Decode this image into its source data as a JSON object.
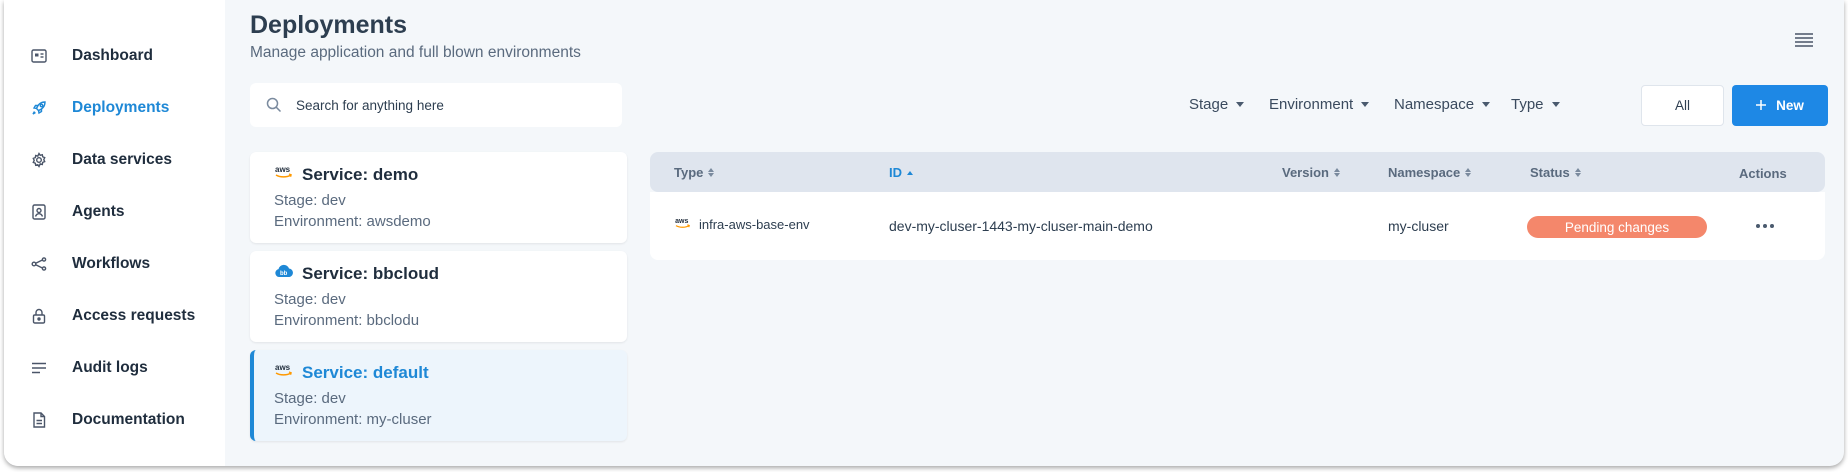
{
  "sidebar": {
    "items": [
      {
        "label": "Dashboard",
        "icon": "dashboard-icon"
      },
      {
        "label": "Deployments",
        "icon": "rocket-icon",
        "active": true
      },
      {
        "label": "Data services",
        "icon": "gear-icon"
      },
      {
        "label": "Agents",
        "icon": "agent-icon"
      },
      {
        "label": "Workflows",
        "icon": "workflow-icon"
      },
      {
        "label": "Access requests",
        "icon": "lock-icon"
      },
      {
        "label": "Audit logs",
        "icon": "list-icon"
      },
      {
        "label": "Documentation",
        "icon": "document-icon"
      }
    ]
  },
  "header": {
    "title": "Deployments",
    "subtitle": "Manage application and full blown environments"
  },
  "search": {
    "placeholder": "Search for anything here",
    "value": ""
  },
  "filters": [
    "Stage",
    "Environment",
    "Namespace",
    "Type"
  ],
  "buttons": {
    "all_label": "All",
    "new_label": "New"
  },
  "services": [
    {
      "name": "Service: demo",
      "stage": "Stage: dev",
      "environment": "Environment: awsdemo",
      "icon": "aws-icon"
    },
    {
      "name": "Service: bbcloud",
      "stage": "Stage: dev",
      "environment": "Environment: bbclodu",
      "icon": "cloud-icon"
    },
    {
      "name": "Service: default",
      "stage": "Stage: dev",
      "environment": "Environment: my-cluser",
      "icon": "aws-icon",
      "selected": true
    }
  ],
  "table": {
    "columns": {
      "type": "Type",
      "id": "ID",
      "version": "Version",
      "namespace": "Namespace",
      "status": "Status",
      "actions": "Actions"
    },
    "rows": [
      {
        "type": "infra-aws-base-env",
        "id": "dev-my-cluser-1443-my-cluser-main-demo",
        "version": "",
        "namespace": "my-cluser",
        "status": "Pending changes"
      }
    ]
  },
  "colors": {
    "accent": "#1e88e5",
    "status_pending": "#f4876b"
  }
}
